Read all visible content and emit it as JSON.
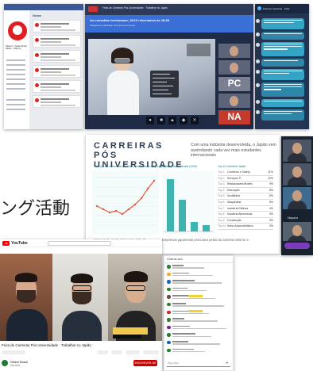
{
  "heading": {
    "text": "ング活動"
  },
  "social_page": {
    "tab_title": "Notas",
    "page_name": "Nikkei Ir. Japão Brasil Nikkei · Página"
  },
  "webinar": {
    "header_title": "Feira de Carreiras Pós Universidade · Trabalhar no Japão",
    "banner_message": "As consultas terminaram, 16/10 retornamos às 18:00",
    "banner_sub": "Obrigado por participar. Nos vemos em breve!",
    "badges": [
      "PC",
      "NA"
    ],
    "controls": [
      "mic-icon",
      "camera-icon",
      "share-icon",
      "record-icon",
      "leave-icon"
    ]
  },
  "chat": {
    "title": "Feira de Carreiras · Chat"
  },
  "slide": {
    "title": "CARREIRAS PÓS UNIVERSIDADE",
    "subtitle": "Com uma indústria desenvolvida, o Japão vem assimilando cada vez mais estudantes internacionais",
    "panel_titles": [
      "Relação de universitários sobre como ficaram empregados",
      "Salário Inicial Mensal (1000)",
      "Top 10 Indústria Japão"
    ],
    "industry_table": [
      {
        "rank": "Top 1",
        "name": "Comércio e Varejo",
        "pct": "11%"
      },
      {
        "rank": "Top 2",
        "name": "Serviços TI",
        "pct": "10%"
      },
      {
        "rank": "Top 3",
        "name": "Restaurantes/Hotéis",
        "pct": "9%"
      },
      {
        "rank": "Top 4",
        "name": "Educação",
        "pct": "8%"
      },
      {
        "rank": "Top 5",
        "name": "Imobiliária",
        "pct": "6%"
      },
      {
        "rank": "Top 6",
        "name": "Maquinaria",
        "pct": "5%"
      },
      {
        "rank": "Top 7",
        "name": "Indústria Elétrica",
        "pct": "4%"
      },
      {
        "rank": "Top 8",
        "name": "Indústria Alimentícia",
        "pct": "3%"
      },
      {
        "rank": "Top 9",
        "name": "Construção",
        "pct": "3%"
      },
      {
        "rank": "Top 10",
        "name": "Setor Automobilístico",
        "pct": "2%"
      }
    ],
    "captions": [
      "Número de graduados com visto de",
      "Empresas japonesas procuram pelos da carreira exterior e"
    ],
    "line_color": "#e4573d",
    "bar_color": "#3fb3b0"
  },
  "video_call": {
    "name_tag": "Nayara"
  },
  "youtube": {
    "brand": "YouTube",
    "video_title": "Feira de Carreiras Pós Universidade · Trabalhar no Japão",
    "channel_name": "Nikkei Brasil",
    "channel_subs": "inscritos",
    "subscribe_label": "INSCREVER-SE"
  },
  "live_chat": {
    "header": "Chat ao vivo",
    "input_placeholder": "Diga algo..."
  }
}
